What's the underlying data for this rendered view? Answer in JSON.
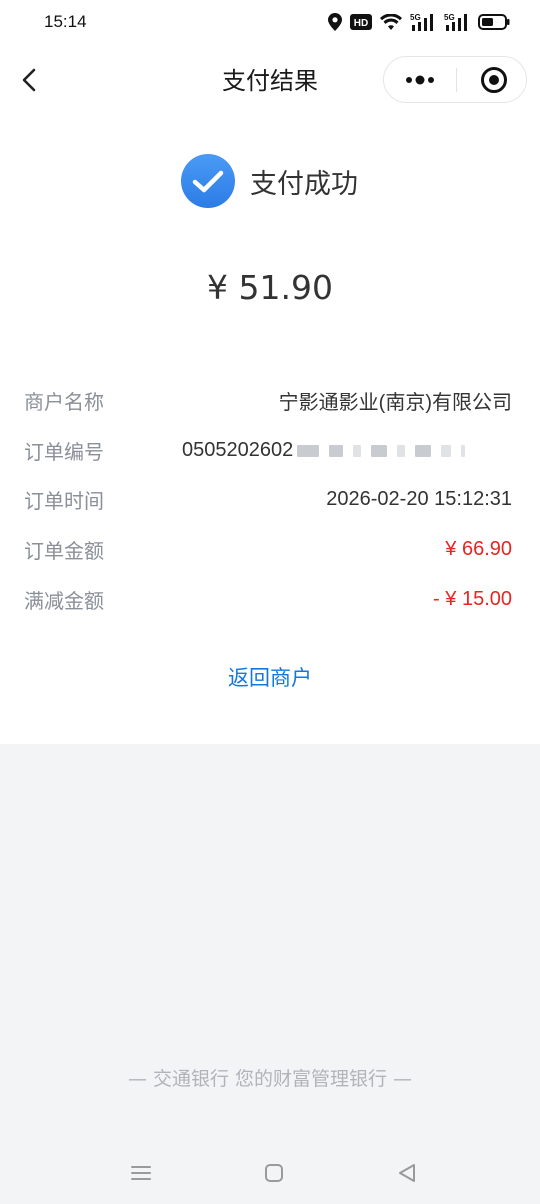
{
  "status_bar": {
    "time": "15:14",
    "icons": [
      "location-icon",
      "hd-icon",
      "wifi-icon",
      "signal-5g-icon",
      "signal-5g-icon",
      "battery-icon"
    ],
    "hd_label": "HD",
    "net_label": "5G"
  },
  "nav": {
    "title": "支付结果",
    "back_icon": "chevron-left-icon",
    "more_icon": "more-dots-icon",
    "close_icon": "target-circle-icon"
  },
  "result": {
    "status_text": "支付成功",
    "status_icon": "check-circle-icon",
    "amount": "¥ 51.90"
  },
  "details": [
    {
      "label": "商户名称",
      "value": "宁影通影业(南京)有限公司"
    },
    {
      "label": "订单编号",
      "value": "0505202602"
    },
    {
      "label": "订单时间",
      "value": "2026-02-20 15:12:31"
    },
    {
      "label": "订单金额",
      "value": "¥ 66.90"
    },
    {
      "label": "满减金额",
      "value": "- ¥ 15.00"
    }
  ],
  "return_label": "返回商户",
  "footer": "— 交通银行 您的财富管理银行 —",
  "system_nav": [
    "menu-icon",
    "home-square-icon",
    "back-triangle-icon"
  ],
  "colors": {
    "accent_blue": "#1677d9",
    "success_blue": "#3b8cf0",
    "negative_red": "#e6261f",
    "label_gray": "#8a8f99"
  }
}
